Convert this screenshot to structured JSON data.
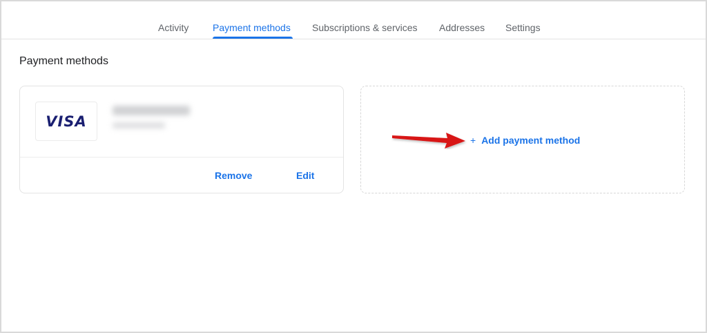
{
  "tabs": [
    {
      "label": "Activity",
      "active": false
    },
    {
      "label": "Payment methods",
      "active": true
    },
    {
      "label": "Subscriptions & services",
      "active": false
    },
    {
      "label": "Addresses",
      "active": false
    },
    {
      "label": "Settings",
      "active": false
    }
  ],
  "page": {
    "title": "Payment methods"
  },
  "card": {
    "brand": "VISA",
    "remove_label": "Remove",
    "edit_label": "Edit"
  },
  "add": {
    "plus": "+",
    "label": "Add payment method"
  },
  "colors": {
    "accent": "#1a73e8",
    "visa": "#1a1f71",
    "annotation_arrow": "#d81313"
  }
}
